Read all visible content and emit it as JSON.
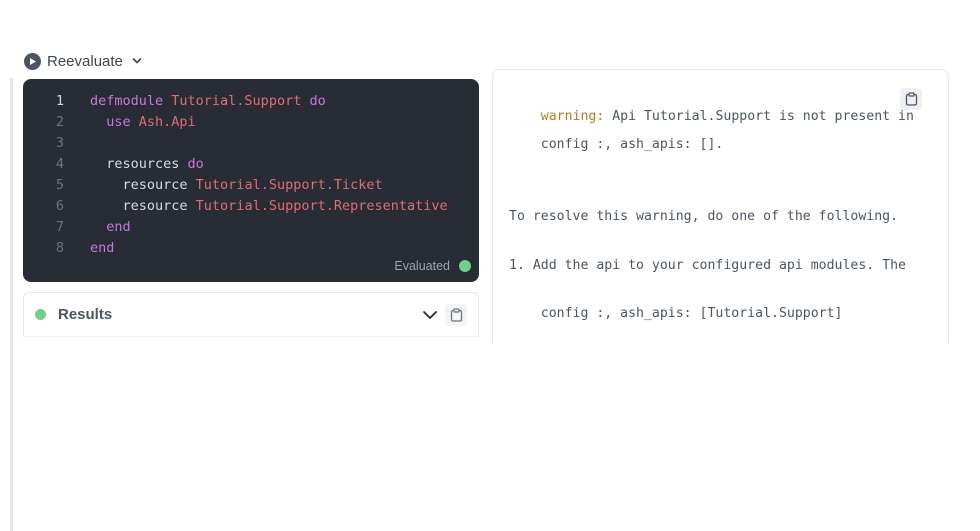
{
  "toolbar": {
    "reevaluate_label": "Reevaluate"
  },
  "editor": {
    "lines": [
      {
        "num": "1",
        "parts": [
          {
            "t": "defmodule ",
            "c": "kw"
          },
          {
            "t": "Tutorial.Support",
            "c": "mod"
          },
          {
            "t": " do",
            "c": "kw"
          }
        ]
      },
      {
        "num": "2",
        "parts": [
          {
            "t": "  "
          },
          {
            "t": "use ",
            "c": "kw"
          },
          {
            "t": "Ash.Api",
            "c": "mod"
          }
        ]
      },
      {
        "num": "3",
        "parts": []
      },
      {
        "num": "4",
        "parts": [
          {
            "t": "  resources "
          },
          {
            "t": "do",
            "c": "kw"
          }
        ]
      },
      {
        "num": "5",
        "parts": [
          {
            "t": "    resource "
          },
          {
            "t": "Tutorial.Support.Ticket",
            "c": "mod"
          }
        ]
      },
      {
        "num": "6",
        "parts": [
          {
            "t": "    resource "
          },
          {
            "t": "Tutorial.Support.Representative",
            "c": "mod"
          }
        ]
      },
      {
        "num": "7",
        "parts": [
          {
            "t": "  "
          },
          {
            "t": "end",
            "c": "kw"
          }
        ]
      },
      {
        "num": "8",
        "parts": [
          {
            "t": "end",
            "c": "kw"
          }
        ]
      }
    ],
    "status": "Evaluated"
  },
  "results": {
    "title": "Results"
  },
  "output": {
    "warning_prefix": "warning:",
    "line1_rest": " Api Tutorial.Support is not present in",
    "line2": "    config :, ash_apis: [].",
    "line3": "To resolve this warning, do one of the following.",
    "line4": "1. Add the api to your configured api modules. The",
    "line5": "    config :, ash_apis: [Tutorial.Support]"
  },
  "colors": {
    "status_green": "#6fd08c",
    "editor_bg": "#282c34",
    "keyword": "#c678dd",
    "module": "#e06c75",
    "warning": "#b7791f"
  }
}
